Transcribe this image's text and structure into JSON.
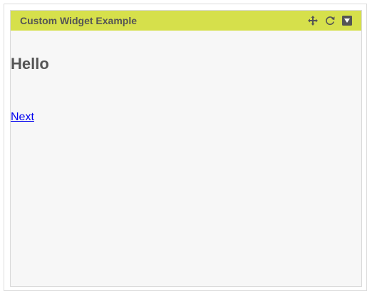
{
  "widget": {
    "title": "Custom Widget Example",
    "header_color": "#d6e04b",
    "controls": [
      {
        "icon": "move-icon"
      },
      {
        "icon": "refresh-icon"
      },
      {
        "icon": "collapse-icon"
      }
    ]
  },
  "content": {
    "heading": "Hello",
    "link_label": "Next"
  }
}
